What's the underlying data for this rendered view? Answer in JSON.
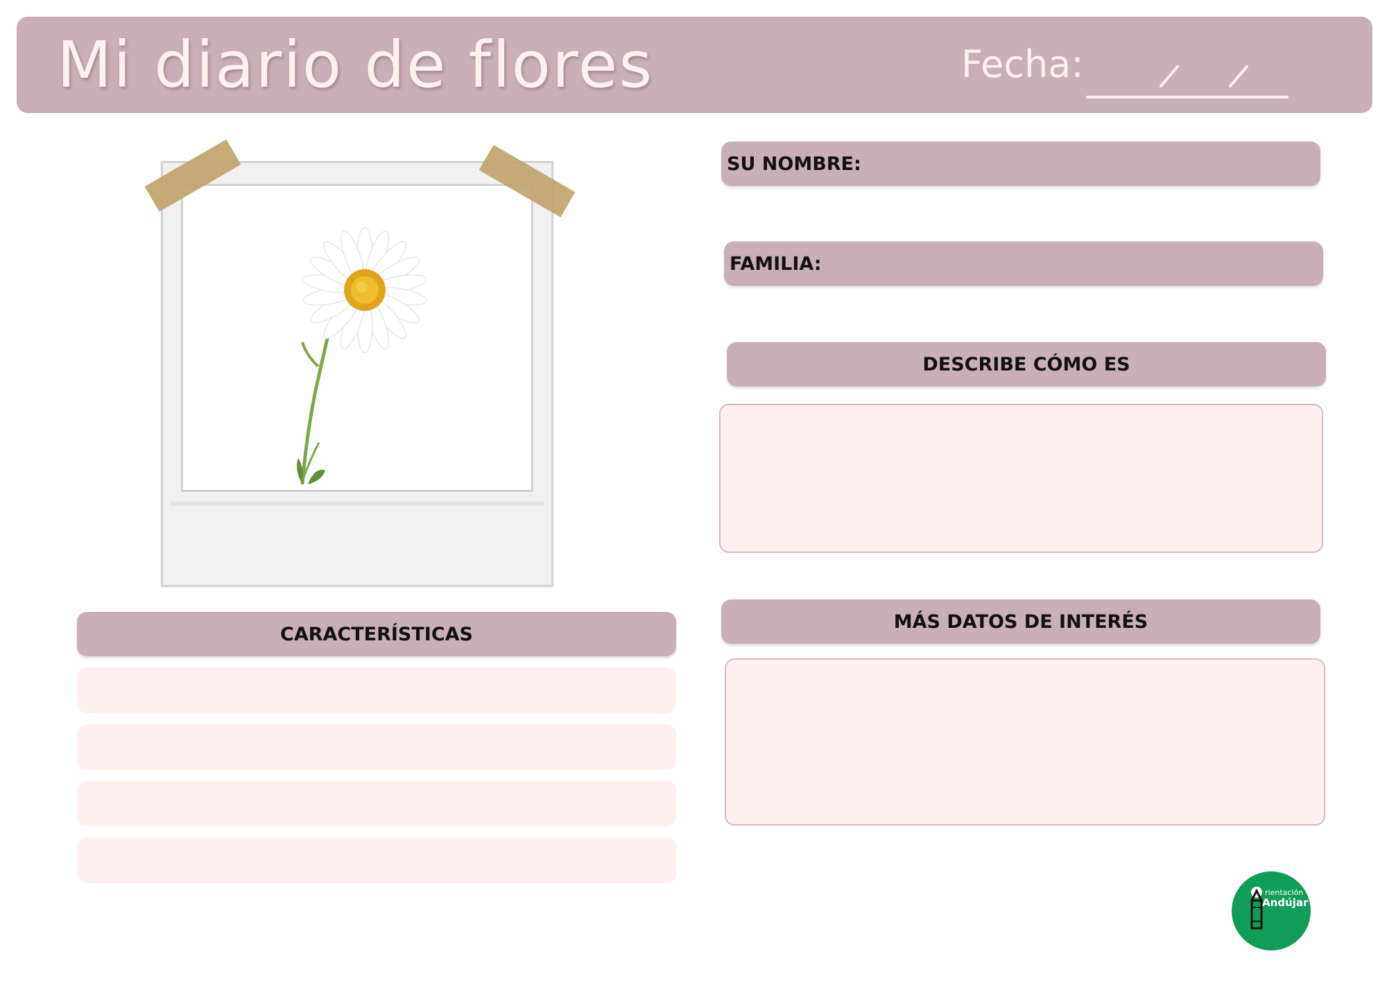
{
  "header": {
    "title": "Mi diario de flores",
    "date_label": "Fecha:",
    "date_separator": "/"
  },
  "photo": {
    "subject": "daisy flower photo in polaroid frame",
    "tape_color": "#bfa46b"
  },
  "fields": {
    "name_label": "SU NOMBRE:",
    "family_label": "FAMILIA:",
    "describe_label": "DESCRIBE CÓMO ES",
    "more_data_label": "MÁS DATOS DE INTERÉS",
    "characteristics_label": "CARACTERÍSTICAS"
  },
  "characteristics_lines": 4,
  "logo": {
    "small_text": "rientación",
    "big_text": "Andújar",
    "color": "#0f9d58"
  },
  "colors": {
    "accent": "#c9afb7",
    "box_fill": "#fdf0ee",
    "box_border": "#d6b8c1",
    "header_text": "#fbf1ee"
  }
}
